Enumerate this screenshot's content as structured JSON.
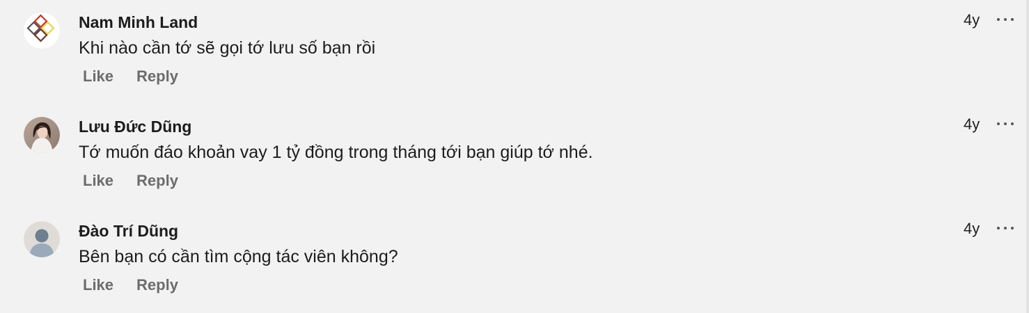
{
  "comments": [
    {
      "author": "Nam Minh Land",
      "text": "Khi nào cần tớ sẽ gọi tớ lưu số bạn rồi",
      "time": "4y",
      "like_label": "Like",
      "reply_label": "Reply",
      "avatar_icon": "diamond-logo-avatar"
    },
    {
      "author": "Lưu Đức Dũng",
      "text": "Tớ muốn đáo khoản vay 1 tỷ đồng trong tháng tới bạn giúp tớ nhé.",
      "time": "4y",
      "like_label": "Like",
      "reply_label": "Reply",
      "avatar_icon": "profile-photo-avatar"
    },
    {
      "author": "Đào Trí Dũng",
      "text": "Bên bạn có cần tìm cộng tác viên không?",
      "time": "4y",
      "like_label": "Like",
      "reply_label": "Reply",
      "avatar_icon": "default-user-avatar"
    }
  ],
  "colors": {
    "background": "#f2f2f2",
    "text": "#1c1c1c",
    "action_text": "#6c6c6c"
  },
  "more_icon": "more-options-icon"
}
